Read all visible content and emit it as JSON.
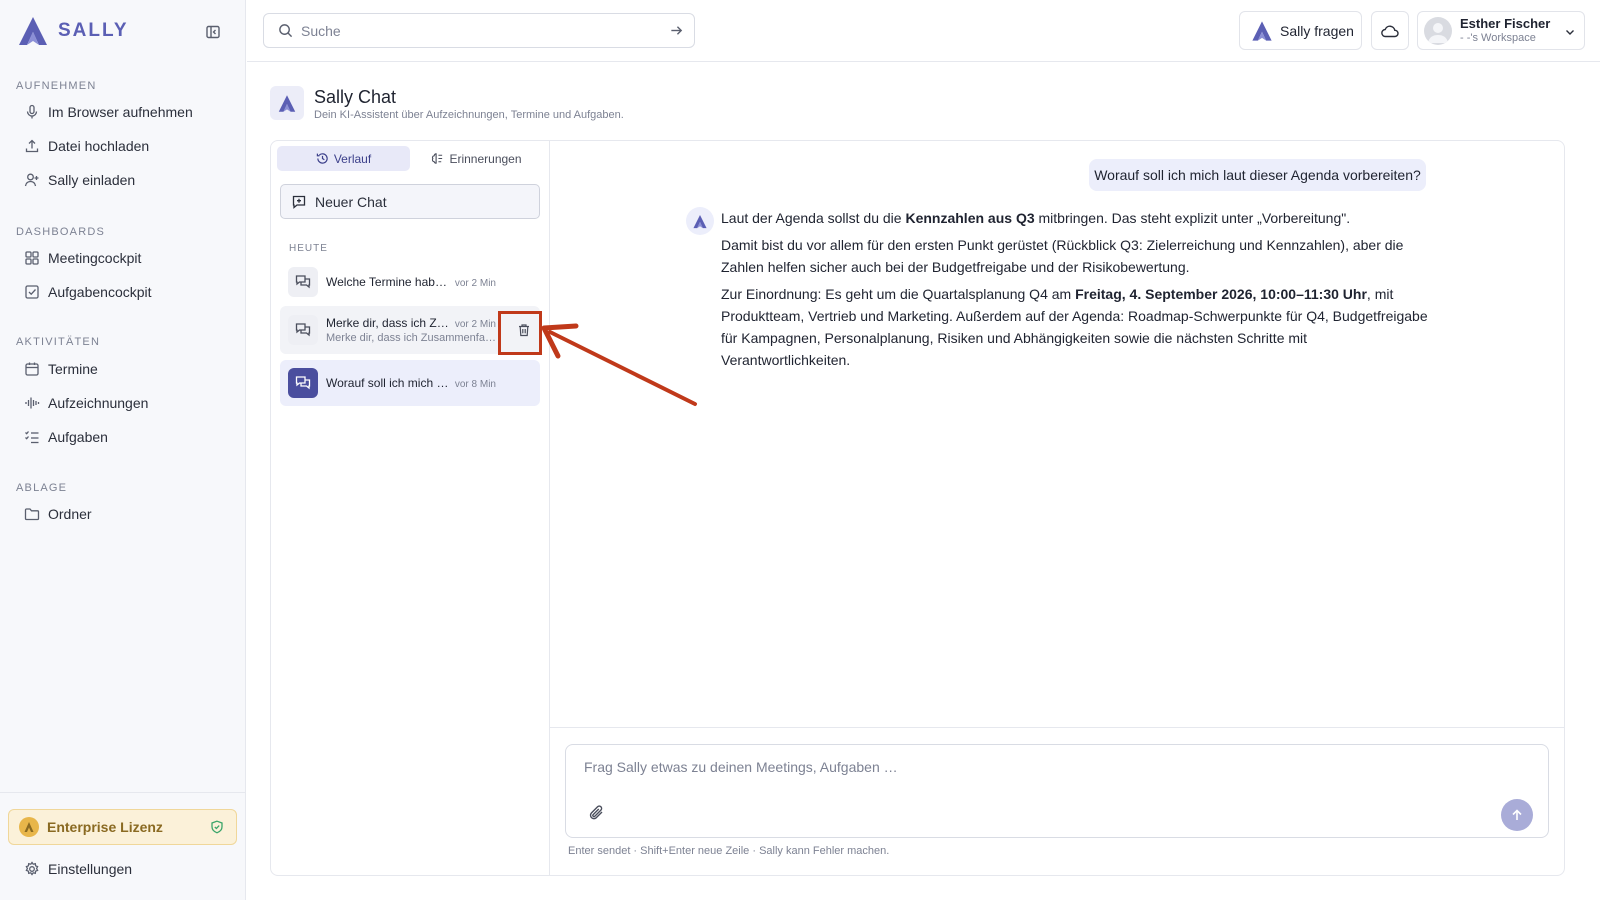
{
  "sidebar": {
    "brand": "SALLY",
    "sections": [
      {
        "label": "AUFNEHMEN"
      },
      {
        "label": "DASHBOARDS"
      },
      {
        "label": "AKTIVITÄTEN"
      },
      {
        "label": "ABLAGE"
      }
    ],
    "items": [
      {
        "label": "Im Browser aufnehmen",
        "icon": "microphone-icon"
      },
      {
        "label": "Datei hochladen",
        "icon": "upload-icon"
      },
      {
        "label": "Sally einladen",
        "icon": "user-plus-icon"
      },
      {
        "label": "Meetingcockpit",
        "icon": "grid-icon"
      },
      {
        "label": "Aufgabencockpit",
        "icon": "checkbox-icon"
      },
      {
        "label": "Termine",
        "icon": "calendar-icon"
      },
      {
        "label": "Aufzeichnungen",
        "icon": "waveform-icon"
      },
      {
        "label": "Aufgaben",
        "icon": "list-check-icon"
      },
      {
        "label": "Ordner",
        "icon": "folder-icon"
      }
    ],
    "license": "Enterprise Lizenz",
    "settings": "Einstellungen"
  },
  "topbar": {
    "search_placeholder": "Suche",
    "ask_label": "Sally fragen",
    "user_name": "Esther Fischer",
    "workspace": "- -'s Workspace"
  },
  "page": {
    "title": "Sally Chat",
    "subtitle": "Dein KI-Assistent über Aufzeichnungen, Termine und Aufgaben."
  },
  "chat_panel": {
    "tabs": [
      {
        "label": "Verlauf",
        "active": true
      },
      {
        "label": "Erinnerungen",
        "active": false
      }
    ],
    "new_chat": "Neuer Chat",
    "group_label": "HEUTE",
    "chats": [
      {
        "title": "Welche Termine habe i...",
        "time": "vor 2 Min",
        "preview": ""
      },
      {
        "title": "Merke dir, dass ich Zus...",
        "time": "vor 2 Min",
        "preview": "Merke dir, dass ich Zusammenfas..."
      },
      {
        "title": "Worauf soll ich mich la...",
        "time": "vor 8 Min",
        "preview": ""
      }
    ]
  },
  "conversation": {
    "user_message": "Worauf soll ich mich laut dieser Agenda vorbereiten?",
    "bot": {
      "p1_a": "Laut der Agenda sollst du die ",
      "p1_b": "Kennzahlen aus Q3",
      "p1_c": " mitbringen. Das steht explizit unter „Vorbereitung\".",
      "p2": "Damit bist du vor allem für den ersten Punkt gerüstet (Rückblick Q3: Zielerreichung und Kennzahlen), aber die Zahlen helfen sicher auch bei der Budgetfreigabe und der Risikobewertung.",
      "p3_a": "Zur Einordnung: Es geht um die Quartalsplanung Q4 am ",
      "p3_b": "Freitag, 4. September 2026, 10:00–11:30 Uhr",
      "p3_c": ", mit Produktteam, Vertrieb und Marketing. Außerdem auf der Agenda: Roadmap-Schwerpunkte für Q4, Budgetfreigabe für Kampagnen, Personalplanung, Risiken und Abhängigkeiten sowie die nächsten Schritte mit Verantwortlichkeiten."
    }
  },
  "composer": {
    "placeholder": "Frag Sally etwas zu deinen Meetings, Aufgaben …",
    "hint": "Enter sendet · Shift+Enter neue Zeile · Sally kann Fehler machen."
  },
  "colors": {
    "brand": "#5b5fb4",
    "accent_bg": "#eceefb",
    "annotation": "#c0391a"
  }
}
